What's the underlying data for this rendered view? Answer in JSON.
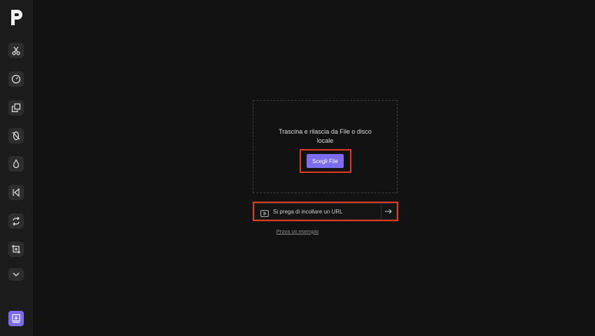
{
  "sidebar": {
    "logo": "p-logo-icon",
    "tools": [
      {
        "name": "scissors-icon"
      },
      {
        "name": "speedometer-icon"
      },
      {
        "name": "copy-icon"
      },
      {
        "name": "crop-rotate-icon"
      },
      {
        "name": "drop-icon"
      },
      {
        "name": "skip-back-icon"
      },
      {
        "name": "loop-icon"
      },
      {
        "name": "crop-add-icon"
      },
      {
        "name": "chevron-down-icon"
      }
    ],
    "download_icon": "download-icon",
    "accent": "#7b6cf0"
  },
  "upload": {
    "drop_text": "Trascina e rilascia da File o disco locale",
    "choose_button": "Scegli File",
    "url_placeholder": "Si prega di incollare un URL",
    "example_link": "Prova un esempio",
    "highlight_color": "#e03a1e"
  }
}
